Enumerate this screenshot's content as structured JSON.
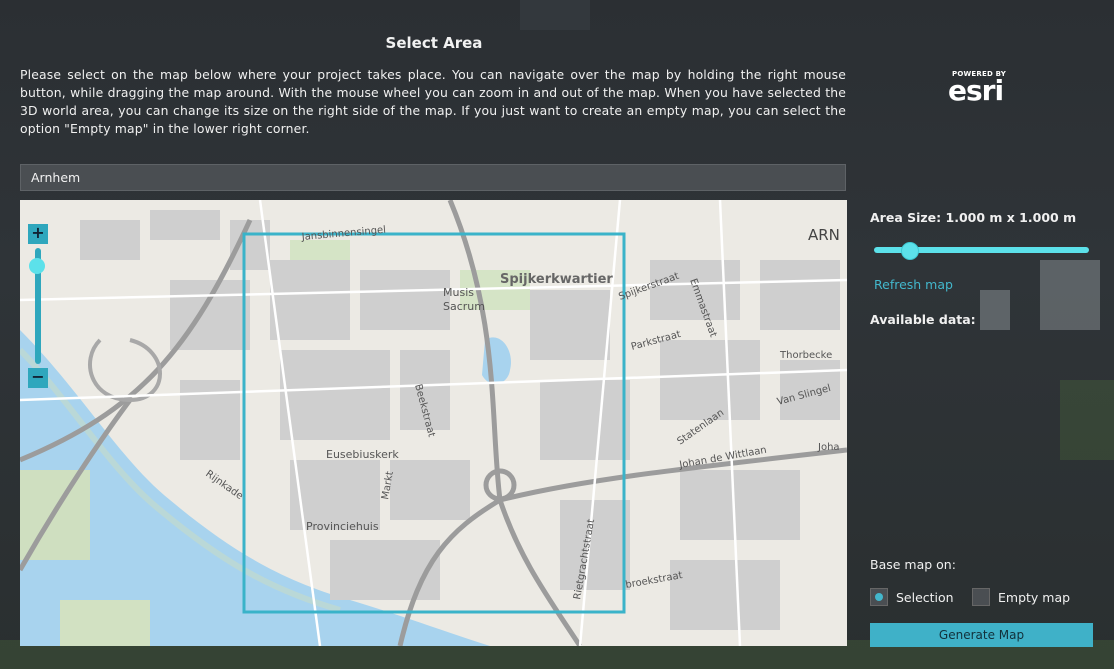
{
  "page": {
    "title": "Select Area",
    "instructions": "Please select on the map below where your project takes place. You can navigate over the map by holding the right mouse button, while dragging the map around. With the mouse wheel you can zoom in and out of the map. When you have selected the 3D world area, you can change its size on the right side of the map. If you just want to create an empty map, you can select the option \"Empty map\" in the lower right corner."
  },
  "brand": {
    "powered_by": "POWERED BY",
    "name": "esri"
  },
  "search": {
    "value": "Arnhem"
  },
  "map": {
    "zoom_in": "+",
    "zoom_out": "−",
    "labels": {
      "spijkerkwartier": "Spijkerkwartier",
      "musis": "Musis",
      "sacrum": "Sacrum",
      "eusebiuskerk": "Eusebiuskerk",
      "provinciehuis": "Provinciehuis",
      "rijnkade": "Rijnkade",
      "beekstraat": "Beekstraat",
      "markt": "Markt",
      "spijkerstraat": "Spijkerstraat",
      "parkstraat": "Parkstraat",
      "emmastraat": "Emmastraat",
      "thorbecke": "Thorbecke",
      "van_slingel": "Van Slingel",
      "statenlaan": "Statenlaan",
      "johan": "Johan de Wittlaan",
      "joha": "Joha",
      "rietgrachtstraat": "Rietgrachtstraat",
      "broekstraat": "broekstraat",
      "jansbinnensingel": "Jansbinnensingel",
      "arn": "ARN"
    }
  },
  "sidebar": {
    "area_size_label": "Area Size: 1.000 m x 1.000 m",
    "area_size_fraction": 0.12,
    "refresh_label": "Refresh map",
    "available_data_label": "Available data:",
    "base_map_label": "Base map on:",
    "options": [
      {
        "label": "Selection",
        "selected": true
      },
      {
        "label": "Empty map",
        "selected": false
      }
    ],
    "generate_label": "Generate Map"
  },
  "colors": {
    "accent": "#43b7cc",
    "selection_box": "#3ab3c9",
    "water": "#a8d3ee",
    "background": "#2d3236"
  }
}
